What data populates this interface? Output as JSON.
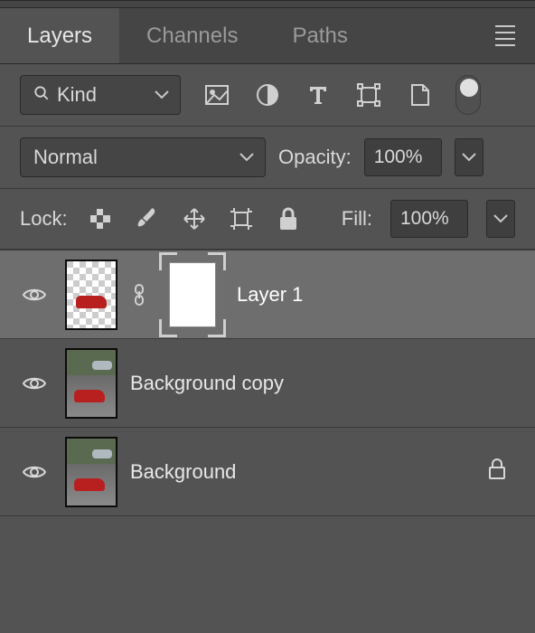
{
  "tabs": {
    "layers": "Layers",
    "channels": "Channels",
    "paths": "Paths"
  },
  "filter": {
    "kind_label": "Kind"
  },
  "blend": {
    "mode": "Normal",
    "opacity_label": "Opacity:",
    "opacity_value": "100%"
  },
  "lock": {
    "label": "Lock:",
    "fill_label": "Fill:",
    "fill_value": "100%"
  },
  "layers": [
    {
      "name": "Layer 1",
      "selected": true,
      "has_mask": true,
      "thumb": "transparent",
      "locked": false
    },
    {
      "name": "Background copy",
      "selected": false,
      "has_mask": false,
      "thumb": "photo",
      "locked": false
    },
    {
      "name": "Background",
      "selected": false,
      "has_mask": false,
      "thumb": "photo",
      "locked": true
    }
  ]
}
